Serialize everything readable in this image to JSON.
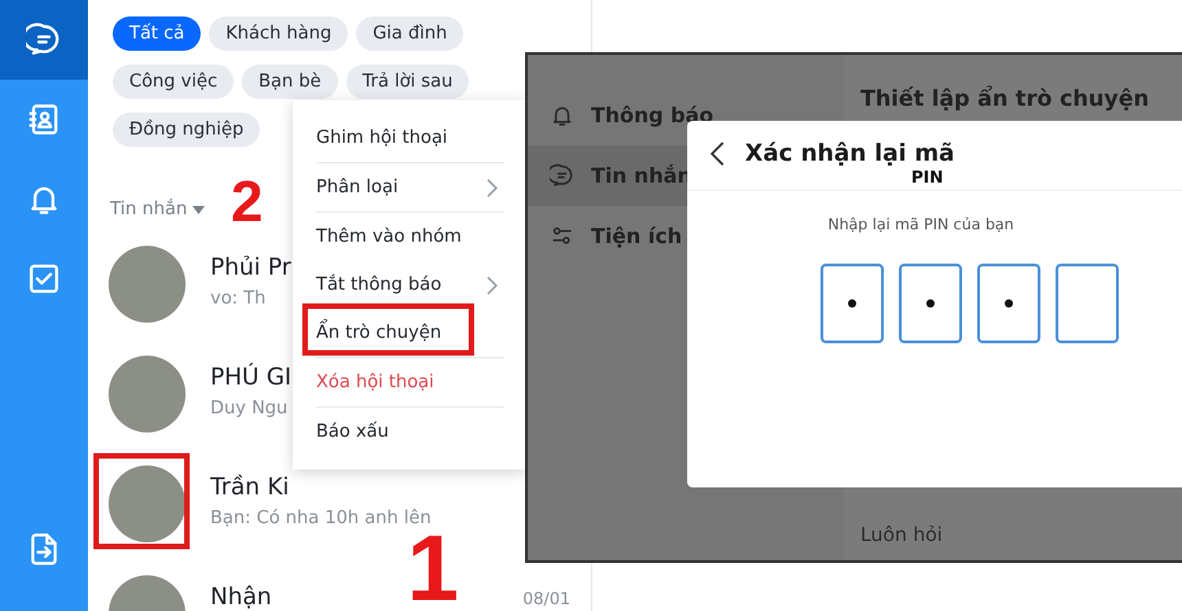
{
  "sidebar": {
    "items": [
      {
        "kind": "chat",
        "selected": true
      },
      {
        "kind": "contacts",
        "selected": false
      },
      {
        "kind": "bell",
        "selected": false
      },
      {
        "kind": "todo",
        "selected": false
      },
      {
        "kind": "exit",
        "selected": false
      }
    ]
  },
  "filters": [
    {
      "label": "Tất cả",
      "selected": true
    },
    {
      "label": "Khách hàng",
      "selected": false
    },
    {
      "label": "Gia đình",
      "selected": false
    },
    {
      "label": "Công việc",
      "selected": false
    },
    {
      "label": "Bạn bè",
      "selected": false
    },
    {
      "label": "Trả lời sau",
      "selected": false
    },
    {
      "label": "Đồng nghiệp",
      "selected": false
    }
  ],
  "list_header": "Tin nhắn",
  "conversations": [
    {
      "name": "Phủi Pr",
      "preview": "vo: Th",
      "annotated": false
    },
    {
      "name": "PHÚ GI",
      "preview": "Duy Ngu",
      "annotated": false
    },
    {
      "name": "Trần Ki",
      "preview": "Bạn: Có nha 10h anh lên",
      "annotated": true
    },
    {
      "name": "Nhận",
      "time": "08/01",
      "annotated": false
    }
  ],
  "context_menu": {
    "items": [
      {
        "label": "Ghim hội thoại",
        "kind": "normal",
        "submenu": false,
        "annotated": false,
        "divider_after": true
      },
      {
        "label": "Phân loại",
        "kind": "normal",
        "submenu": true,
        "annotated": false,
        "divider_after": true
      },
      {
        "label": "Thêm vào nhóm",
        "kind": "normal",
        "submenu": false,
        "annotated": false,
        "divider_after": false
      },
      {
        "label": "Tắt thông báo",
        "kind": "normal",
        "submenu": true,
        "annotated": false,
        "divider_after": false
      },
      {
        "label": "Ẩn trò chuyện",
        "kind": "normal",
        "submenu": false,
        "annotated": true,
        "divider_after": true
      },
      {
        "label": "Xóa hội thoại",
        "kind": "danger",
        "submenu": false,
        "annotated": false,
        "divider_after": true
      },
      {
        "label": "Báo xấu",
        "kind": "normal",
        "submenu": false,
        "annotated": false,
        "divider_after": false
      }
    ]
  },
  "step_markers": [
    "2",
    "1"
  ],
  "settings_window": {
    "nav": [
      {
        "label": "Thông báo",
        "kind": "bell",
        "selected": false
      },
      {
        "label": "Tin nhắn",
        "kind": "chat",
        "selected": true
      },
      {
        "label": "Tiện ích",
        "kind": "sliders",
        "selected": false
      }
    ],
    "heading": "Thiết lập ẩn trò chuyện",
    "option": "Luôn hỏi",
    "dialog": {
      "title": "Xác nhận lại mã",
      "title_overflow": "PIN",
      "prompt": "Nhập lại mã PIN của bạn",
      "pin": [
        {
          "filled": true
        },
        {
          "filled": true
        },
        {
          "filled": true
        },
        {
          "filled": false
        }
      ]
    }
  }
}
